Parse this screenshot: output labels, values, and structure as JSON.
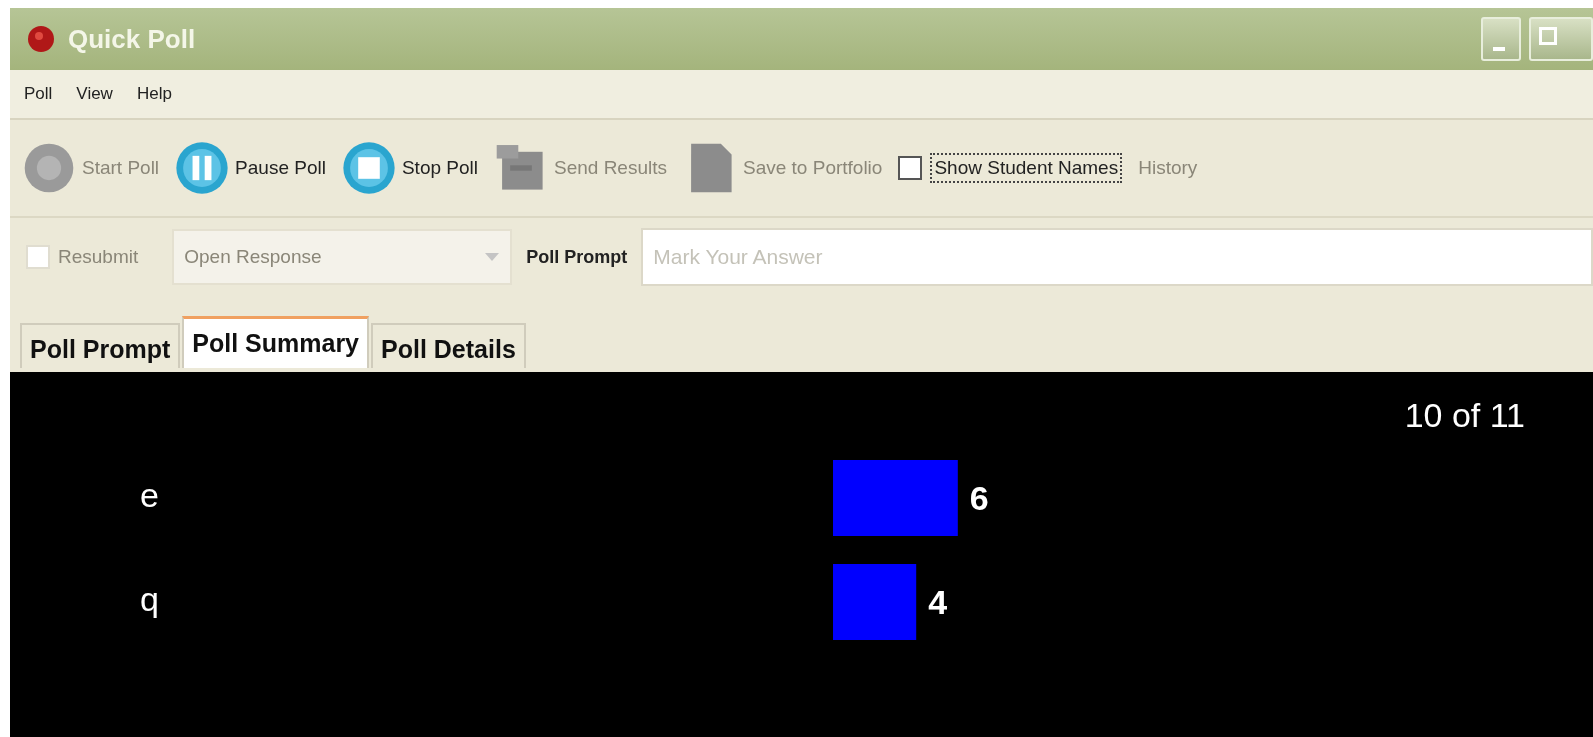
{
  "window": {
    "title": "Quick Poll"
  },
  "menu": [
    {
      "label": "Poll"
    },
    {
      "label": "View"
    },
    {
      "label": "Help"
    }
  ],
  "toolbar": [
    {
      "kind": "start",
      "label": "Start Poll",
      "disabled": true
    },
    {
      "kind": "pause",
      "label": "Pause Poll",
      "disabled": false
    },
    {
      "kind": "stop",
      "label": "Stop Poll",
      "disabled": false
    },
    {
      "kind": "send",
      "label": "Send Results",
      "disabled": true
    },
    {
      "kind": "save",
      "label": "Save to Portfolio",
      "disabled": true
    },
    {
      "kind": "checkbox",
      "label": "Show Student Names",
      "checked": false,
      "disabled": false
    },
    {
      "kind": "text",
      "label": "History",
      "disabled": true
    }
  ],
  "options": {
    "resubmit": {
      "label": "Resubmit",
      "checked": false,
      "disabled": true
    },
    "type_select": {
      "value": "Open Response",
      "disabled": true
    },
    "prompt": {
      "label": "Poll Prompt",
      "placeholder": "Mark Your Answer"
    }
  },
  "tabs": [
    {
      "label": "Poll Prompt",
      "selected": false
    },
    {
      "label": "Poll Summary",
      "selected": true
    },
    {
      "label": "Poll Details",
      "selected": false
    }
  ],
  "summary": {
    "count": "10 of 11",
    "chart_data": {
      "type": "bar",
      "orientation": "horizontal",
      "categories": [
        "e",
        "q"
      ],
      "values": [
        6,
        4
      ],
      "data_labels": true
    }
  }
}
